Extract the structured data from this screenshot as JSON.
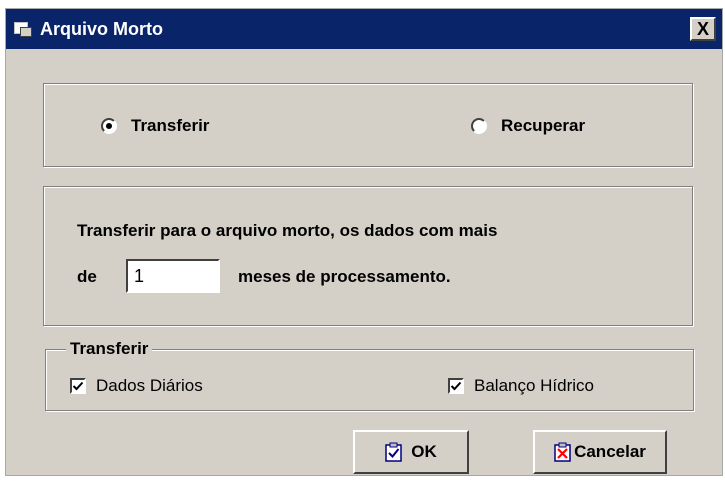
{
  "window": {
    "title": "Arquivo Morto",
    "close_label": "X"
  },
  "mode": {
    "options": [
      {
        "label": "Transferir",
        "selected": true
      },
      {
        "label": "Recuperar",
        "selected": false
      }
    ]
  },
  "transfer": {
    "line1": "Transferir para o arquivo morto, os dados com mais",
    "prefix": "de",
    "months_value": "1",
    "suffix": "meses de processamento."
  },
  "group": {
    "legend": "Transferir",
    "checkboxes": [
      {
        "label": "Dados Diários",
        "checked": true
      },
      {
        "label": "Balanço Hídrico",
        "checked": true
      }
    ]
  },
  "buttons": {
    "ok": "OK",
    "cancel": "Cancelar"
  },
  "icons": {
    "app": "form-icon",
    "ok": "clipboard-check-icon",
    "cancel": "clipboard-x-icon"
  },
  "colors": {
    "titlebar": "#0a246a",
    "face": "#d4d0c8",
    "cancel_x": "#ff0000"
  }
}
